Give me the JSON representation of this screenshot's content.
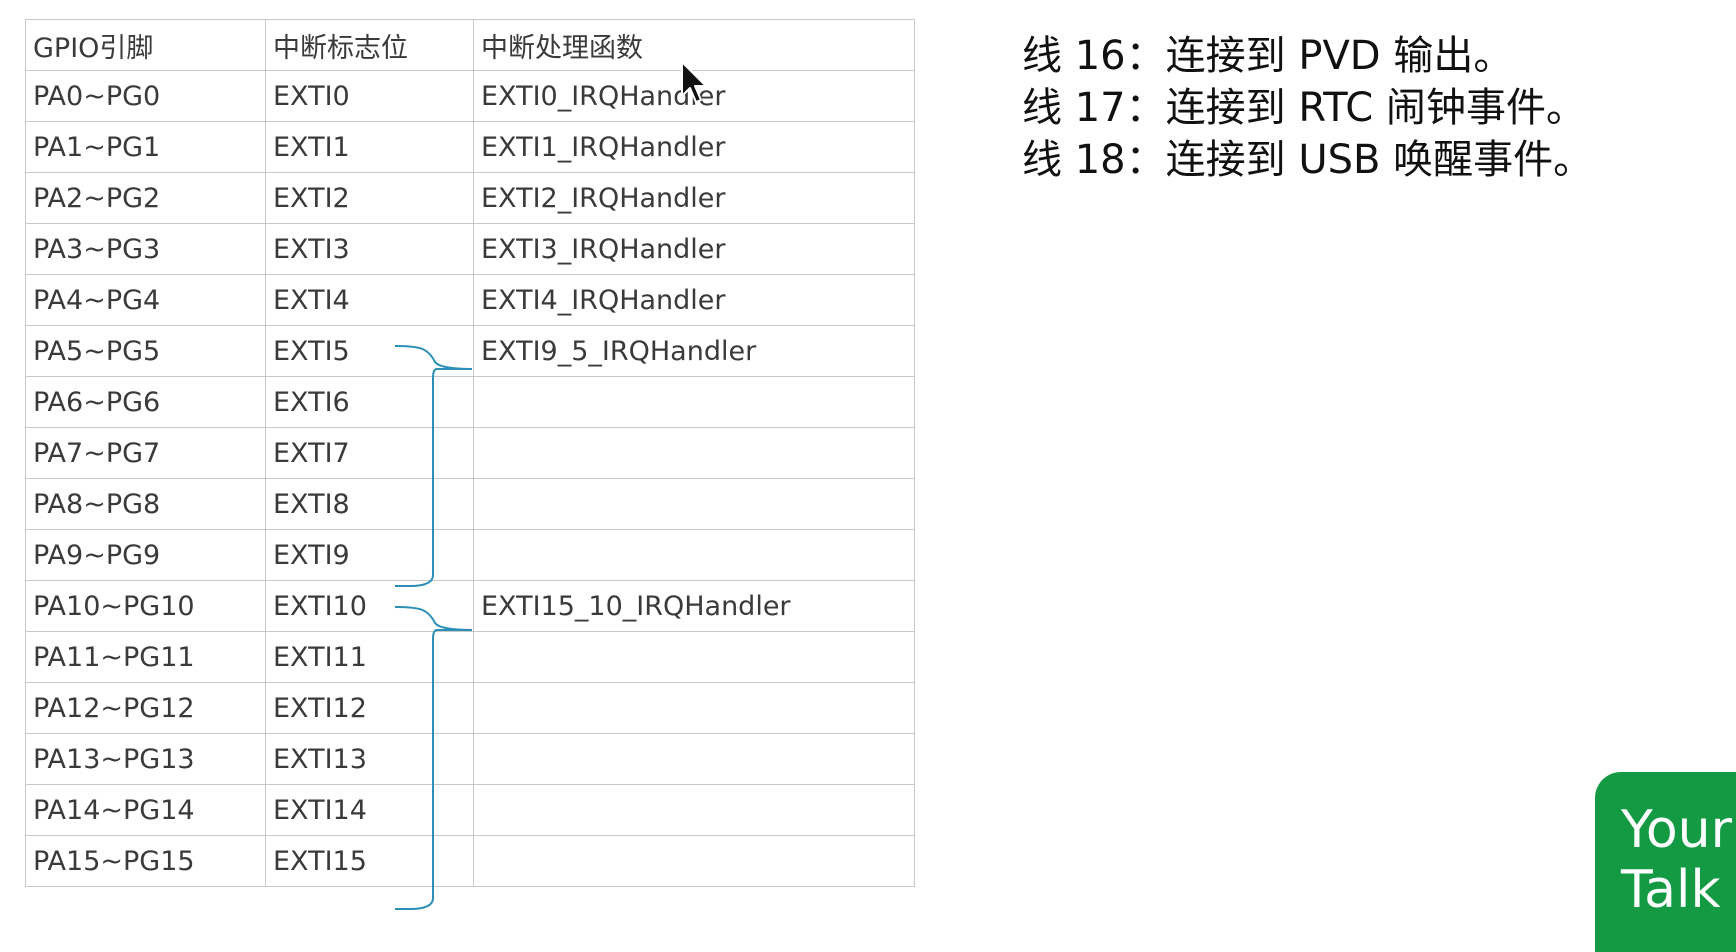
{
  "table": {
    "headers": [
      "GPIO引脚",
      "中断标志位",
      "中断处理函数"
    ],
    "rows": [
      [
        "PA0~PG0",
        "EXTI0",
        "EXTI0_IRQHandler"
      ],
      [
        "PA1~PG1",
        "EXTI1",
        "EXTI1_IRQHandler"
      ],
      [
        "PA2~PG2",
        "EXTI2",
        "EXTI2_IRQHandler"
      ],
      [
        "PA3~PG3",
        "EXTI3",
        "EXTI3_IRQHandler"
      ],
      [
        "PA4~PG4",
        "EXTI4",
        "EXTI4_IRQHandler"
      ],
      [
        "PA5~PG5",
        "EXTI5",
        "EXTI9_5_IRQHandler"
      ],
      [
        "PA6~PG6",
        "EXTI6",
        ""
      ],
      [
        "PA7~PG7",
        "EXTI7",
        ""
      ],
      [
        "PA8~PG8",
        "EXTI8",
        ""
      ],
      [
        "PA9~PG9",
        "EXTI9",
        ""
      ],
      [
        "PA10~PG10",
        "EXTI10",
        "EXTI15_10_IRQHandler"
      ],
      [
        "PA11~PG11",
        "EXTI11",
        ""
      ],
      [
        "PA12~PG12",
        "EXTI12",
        ""
      ],
      [
        "PA13~PG13",
        "EXTI13",
        ""
      ],
      [
        "PA14~PG14",
        "EXTI14",
        ""
      ],
      [
        "PA15~PG15",
        "EXTI15",
        ""
      ]
    ]
  },
  "notes": [
    "线 16：连接到 PVD 输出。",
    "线 17：连接到 RTC 闹钟事件。",
    "线 18：连接到 USB 唤醒事件。"
  ],
  "chat_bubble": {
    "line1": "Your",
    "line2": "Talk"
  },
  "colors": {
    "brace": "#2b8fb5",
    "bubble": "#139a43",
    "grid": "#c8c8c8"
  },
  "icons": {
    "cursor": "mouse-pointer-icon"
  }
}
